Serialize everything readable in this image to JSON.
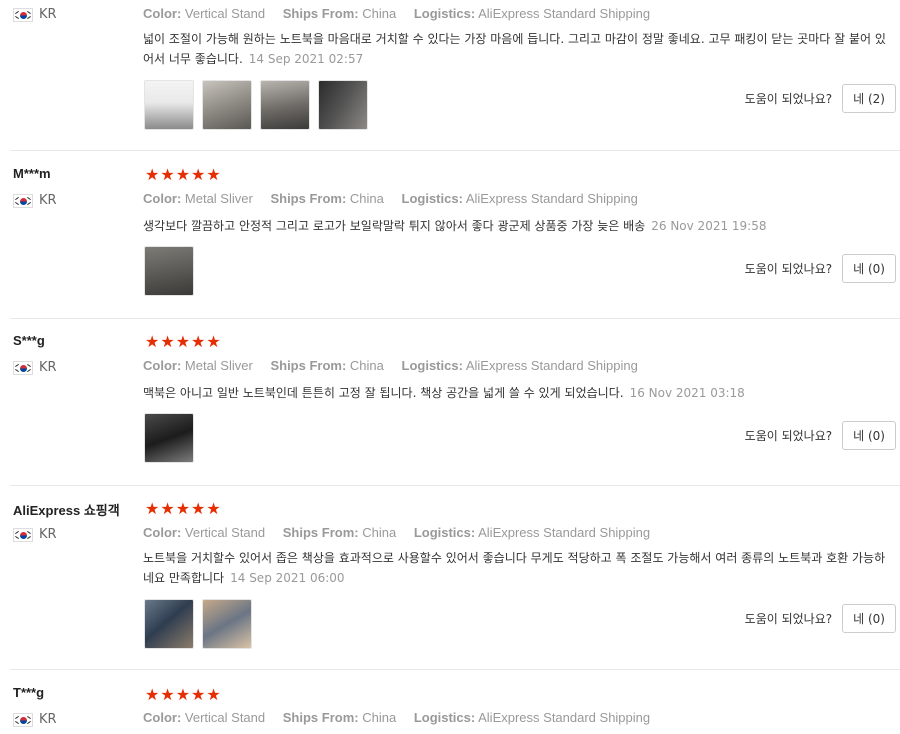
{
  "colors": {
    "stars": "#e62e04",
    "meta": "#999999",
    "border": "#e8e8e8"
  },
  "icons": {
    "flag": "kr-flag-icon",
    "star": "star-icon"
  },
  "helpful_question": "도움이 되었나요?",
  "reviews": [
    {
      "user": "",
      "country": "KR",
      "stars": "★★★★★",
      "color_label": "Color:",
      "color": "Vertical Stand",
      "ships_label": "Ships From:",
      "ships": "China",
      "logistics_label": "Logistics:",
      "logistics": "AliExpress Standard Shipping",
      "text": "넓이 조절이 가능해 원하는 노트북을 마음대로 거치할 수 있다는 가장 마음에 듭니다. 그리고 마감이 정말 좋네요. 고무 패킹이 닫는 곳마다 잘 붙어 있어서 너무 좋습니다.",
      "date": "14 Sep 2021 02:57",
      "helpful_button": "네 (2)"
    },
    {
      "user": "M***m",
      "country": "KR",
      "stars": "★★★★★",
      "color_label": "Color:",
      "color": "Metal Sliver",
      "ships_label": "Ships From:",
      "ships": "China",
      "logistics_label": "Logistics:",
      "logistics": "AliExpress Standard Shipping",
      "text": "생각보다 깔끔하고 안정적 그리고 로고가 보일락말락 튀지 않아서 좋다 광군제 상품중 가장 늦은 배송",
      "date": "26 Nov 2021 19:58",
      "helpful_button": "네 (0)"
    },
    {
      "user": "S***g",
      "country": "KR",
      "stars": "★★★★★",
      "color_label": "Color:",
      "color": "Metal Sliver",
      "ships_label": "Ships From:",
      "ships": "China",
      "logistics_label": "Logistics:",
      "logistics": "AliExpress Standard Shipping",
      "text": "맥북은 아니고 일반 노트북인데 튼튼히 고정 잘 됩니다. 책상 공간을 넓게 쓸 수 있게 되었습니다.",
      "date": "16 Nov 2021 03:18",
      "helpful_button": "네 (0)"
    },
    {
      "user": "AliExpress 쇼핑객",
      "country": "KR",
      "stars": "★★★★★",
      "color_label": "Color:",
      "color": "Vertical Stand",
      "ships_label": "Ships From:",
      "ships": "China",
      "logistics_label": "Logistics:",
      "logistics": "AliExpress Standard Shipping",
      "text": "노트북을 거치할수 있어서 좁은 책상을 효과적으로 사용할수 있어서 좋습니다 무게도 적당하고 폭 조절도 가능해서 여러 종류의 노트북과 호환 가능하네요 만족합니다",
      "date": "14 Sep 2021 06:00",
      "helpful_button": "네 (0)"
    },
    {
      "user": "T***g",
      "country": "KR",
      "stars": "★★★★★",
      "color_label": "Color:",
      "color": "Vertical Stand",
      "ships_label": "Ships From:",
      "ships": "China",
      "logistics_label": "Logistics:",
      "logistics": "AliExpress Standard Shipping"
    }
  ]
}
